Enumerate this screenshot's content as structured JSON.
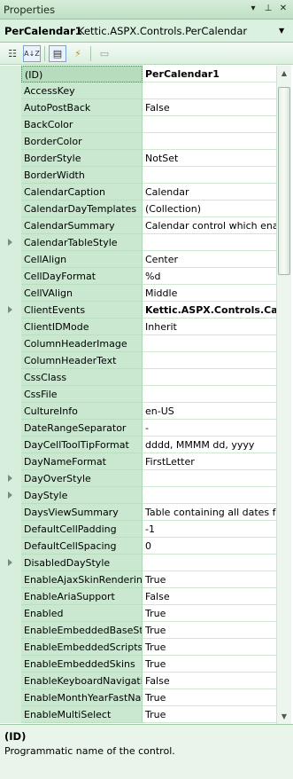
{
  "window": {
    "title": "Properties",
    "pin_glyph": "▾ ⊥ ✕"
  },
  "selector": {
    "name": "PerCalendar1",
    "type": "Kettic.ASPX.Controls.PerCalendar",
    "dropdown_glyph": "▼"
  },
  "toolbar": {
    "categorized": "☷",
    "alphabetical": "A↓Z",
    "properties": "▤",
    "events": "⚡",
    "property_pages": "▭"
  },
  "properties": [
    {
      "name": "(ID)",
      "value": "PerCalendar1",
      "bold": true,
      "expandable": false,
      "selected": true
    },
    {
      "name": "AccessKey",
      "value": "",
      "bold": false,
      "expandable": false
    },
    {
      "name": "AutoPostBack",
      "value": "False",
      "bold": false,
      "expandable": false
    },
    {
      "name": "BackColor",
      "value": "",
      "bold": false,
      "expandable": false
    },
    {
      "name": "BorderColor",
      "value": "",
      "bold": false,
      "expandable": false
    },
    {
      "name": "BorderStyle",
      "value": "NotSet",
      "bold": false,
      "expandable": false
    },
    {
      "name": "BorderWidth",
      "value": "",
      "bold": false,
      "expandable": false
    },
    {
      "name": "CalendarCaption",
      "value": "Calendar",
      "bold": false,
      "expandable": false
    },
    {
      "name": "CalendarDayTemplates",
      "value": "(Collection)",
      "bold": false,
      "expandable": false
    },
    {
      "name": "CalendarSummary",
      "value": "Calendar control which enal",
      "bold": false,
      "expandable": false
    },
    {
      "name": "CalendarTableStyle",
      "value": "",
      "bold": false,
      "expandable": true
    },
    {
      "name": "CellAlign",
      "value": "Center",
      "bold": false,
      "expandable": false
    },
    {
      "name": "CellDayFormat",
      "value": "%d",
      "bold": false,
      "expandable": false
    },
    {
      "name": "CellVAlign",
      "value": "Middle",
      "bold": false,
      "expandable": false
    },
    {
      "name": "ClientEvents",
      "value": "Kettic.ASPX.Controls.Calen",
      "bold": true,
      "expandable": true
    },
    {
      "name": "ClientIDMode",
      "value": "Inherit",
      "bold": false,
      "expandable": false
    },
    {
      "name": "ColumnHeaderImage",
      "value": "",
      "bold": false,
      "expandable": false
    },
    {
      "name": "ColumnHeaderText",
      "value": "",
      "bold": false,
      "expandable": false
    },
    {
      "name": "CssClass",
      "value": "",
      "bold": false,
      "expandable": false
    },
    {
      "name": "CssFile",
      "value": "",
      "bold": false,
      "expandable": false
    },
    {
      "name": "CultureInfo",
      "value": "en-US",
      "bold": false,
      "expandable": false
    },
    {
      "name": "DateRangeSeparator",
      "value": " -",
      "bold": false,
      "expandable": false
    },
    {
      "name": "DayCellToolTipFormat",
      "value": "dddd, MMMM dd, yyyy",
      "bold": false,
      "expandable": false
    },
    {
      "name": "DayNameFormat",
      "value": "FirstLetter",
      "bold": false,
      "expandable": false
    },
    {
      "name": "DayOverStyle",
      "value": "",
      "bold": false,
      "expandable": true
    },
    {
      "name": "DayStyle",
      "value": "",
      "bold": false,
      "expandable": true
    },
    {
      "name": "DaysViewSummary",
      "value": "Table containing all dates fo",
      "bold": false,
      "expandable": false
    },
    {
      "name": "DefaultCellPadding",
      "value": "-1",
      "bold": false,
      "expandable": false
    },
    {
      "name": "DefaultCellSpacing",
      "value": "0",
      "bold": false,
      "expandable": false
    },
    {
      "name": "DisabledDayStyle",
      "value": "",
      "bold": false,
      "expandable": true
    },
    {
      "name": "EnableAjaxSkinRendering",
      "value": "True",
      "bold": false,
      "expandable": false
    },
    {
      "name": "EnableAriaSupport",
      "value": "False",
      "bold": false,
      "expandable": false
    },
    {
      "name": "Enabled",
      "value": "True",
      "bold": false,
      "expandable": false
    },
    {
      "name": "EnableEmbeddedBaseSty",
      "value": "True",
      "bold": false,
      "expandable": false
    },
    {
      "name": "EnableEmbeddedScripts",
      "value": "True",
      "bold": false,
      "expandable": false
    },
    {
      "name": "EnableEmbeddedSkins",
      "value": "True",
      "bold": false,
      "expandable": false
    },
    {
      "name": "EnableKeyboardNavigatic",
      "value": "False",
      "bold": false,
      "expandable": false
    },
    {
      "name": "EnableMonthYearFastNav",
      "value": "True",
      "bold": false,
      "expandable": false
    },
    {
      "name": "EnableMultiSelect",
      "value": "True",
      "bold": false,
      "expandable": false
    }
  ],
  "scrollbar": {
    "up_glyph": "▲",
    "down_glyph": "▼"
  },
  "description": {
    "title": "(ID)",
    "text": "Programmatic name of the control."
  }
}
